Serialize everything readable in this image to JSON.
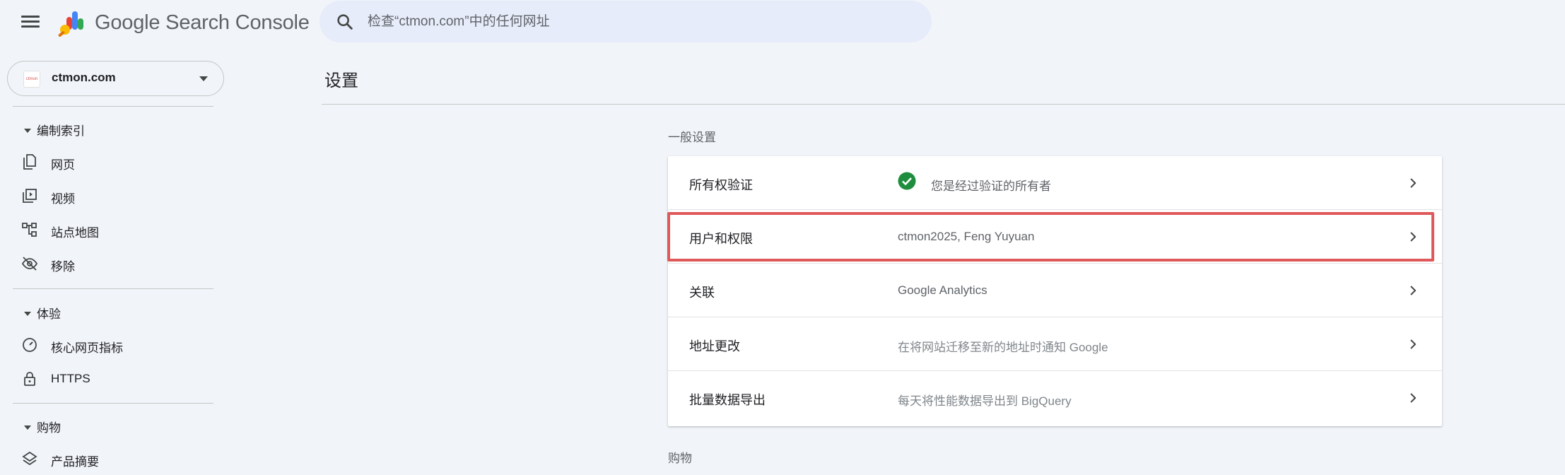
{
  "header": {
    "product_name": "Google Search Console",
    "search_placeholder": "检查“ctmon.com”中的任何网址"
  },
  "sidebar": {
    "property": "ctmon.com",
    "sections": [
      {
        "title": "编制索引",
        "items": [
          {
            "label": "网页",
            "icon": "page-icon"
          },
          {
            "label": "视频",
            "icon": "video-icon"
          },
          {
            "label": "站点地图",
            "icon": "sitemap-icon"
          },
          {
            "label": "移除",
            "icon": "hidden-eye-icon"
          }
        ]
      },
      {
        "title": "体验",
        "items": [
          {
            "label": "核心网页指标",
            "icon": "speedometer-icon"
          },
          {
            "label": "HTTPS",
            "icon": "lock-icon"
          }
        ]
      },
      {
        "title": "购物",
        "items": [
          {
            "label": "产品摘要",
            "icon": "layers-icon"
          }
        ]
      }
    ]
  },
  "main": {
    "page_title": "设置",
    "general_label": "一般设置",
    "settings_rows": [
      {
        "label": "所有权验证",
        "value": "您是经过验证的所有者",
        "status_icon": "check-circle-icon",
        "status_color": "#1e8e3e"
      },
      {
        "label": "用户和权限",
        "value": "ctmon2025, Feng Yuyuan"
      },
      {
        "label": "关联",
        "value": "Google Analytics"
      },
      {
        "label": "地址更改",
        "value": "在将网站迁移至新的地址时通知 Google"
      },
      {
        "label": "批量数据导出",
        "value": "每天将性能数据导出到 BigQuery"
      }
    ],
    "shopping_label": "购物"
  },
  "colors": {
    "background": "#f1f4f9",
    "search_bg": "#e6ecfa",
    "highlight": "#e0595a",
    "check": "#1e8e3e"
  }
}
